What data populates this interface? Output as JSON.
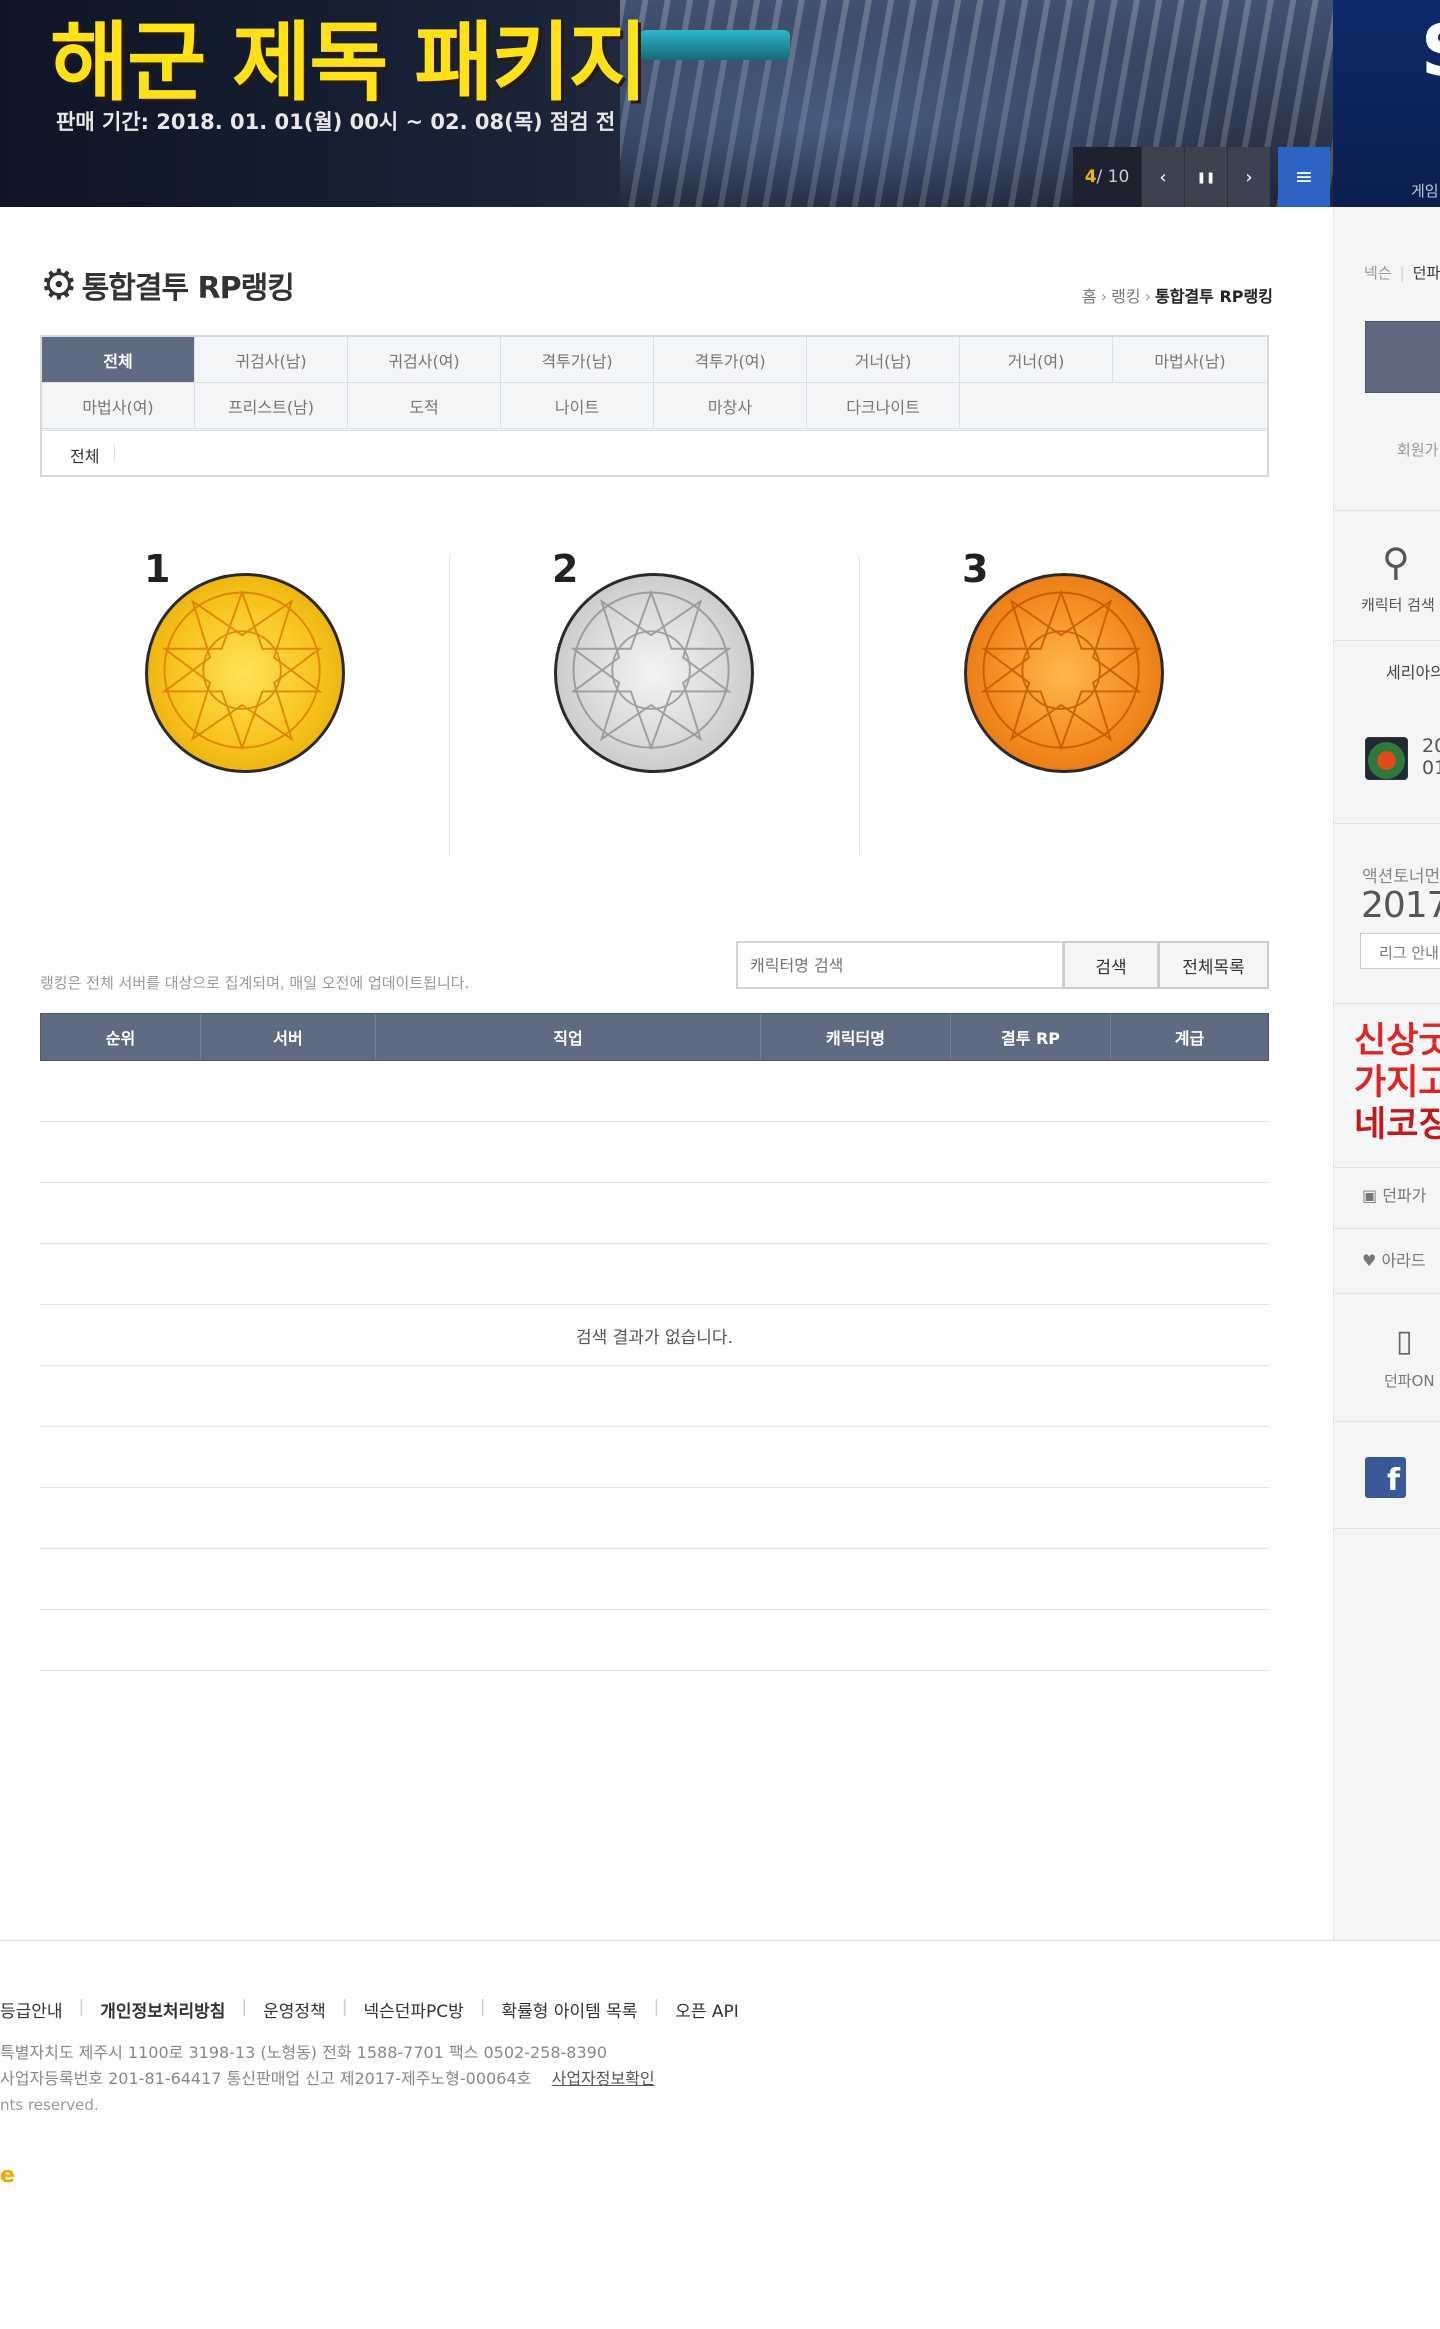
{
  "banner": {
    "title": "해군 제독 패키지",
    "subtitle": "판매 기간: 2018. 01. 01(월) 00시 ~ 02. 08(목) 점검 전",
    "counter_current": "4",
    "counter_total": "/ 10",
    "prev_icon": "‹",
    "pause_icon": "❚❚",
    "next_icon": "›",
    "menu_icon": "≡",
    "right_letter": "S",
    "right_label": "게임"
  },
  "sidebar": {
    "login_left": "넥슨",
    "login_right": "던파",
    "join": "회원가",
    "char_search": "캐릭터 검색",
    "server": "세리아의",
    "avatar_num1": "20",
    "avatar_num2": "01",
    "tournament": "액션토너먼",
    "year": "2017 I",
    "league": "리그 안내",
    "ad_line1": "신상굿",
    "ad_line2": "가지고",
    "ad_line3": "네코징",
    "dfg": "던파가",
    "ara": "아라드",
    "dfon": "던파ON",
    "fb": "f"
  },
  "page": {
    "title": "통합결투 RP랭킹",
    "breadcrumb": [
      "홈",
      "랭킹",
      "통합결투 RP랭킹"
    ]
  },
  "tabs": [
    {
      "label": "전체",
      "active": true
    },
    {
      "label": "귀검사(남)"
    },
    {
      "label": "귀검사(여)"
    },
    {
      "label": "격투가(남)"
    },
    {
      "label": "격투가(여)"
    },
    {
      "label": "거너(남)"
    },
    {
      "label": "거너(여)"
    },
    {
      "label": "마법사(남)"
    },
    {
      "label": "마법사(여)"
    },
    {
      "label": "프리스트(남)"
    },
    {
      "label": "도적"
    },
    {
      "label": "나이트"
    },
    {
      "label": "마창사"
    },
    {
      "label": "다크나이트"
    }
  ],
  "subtab": "전체",
  "medals": [
    "1",
    "2",
    "3"
  ],
  "search": {
    "notice": "랭킹은 전체 서버를 대상으로 집계되며, 매일 오전에 업데이트됩니다.",
    "placeholder": "캐릭터명 검색",
    "search_btn": "검색",
    "list_btn": "전체목록"
  },
  "table": {
    "headers": [
      "순위",
      "서버",
      "직업",
      "캐릭터명",
      "결투 RP",
      "계급"
    ],
    "empty_message": "검색 결과가 없습니다."
  },
  "footer": {
    "links": [
      "등급안내",
      "개인정보처리방침",
      "운영정책",
      "넥슨던파PC방",
      "확률형 아이템 목록",
      "오픈 API"
    ],
    "address": "특별자치도 제주시 1100로 3198-13 (노형동)    전화 1588-7701    팩스 0502-258-8390",
    "registration": "사업자등록번호 201-81-64417    통신판매업 신고 제2017-제주노형-00064호",
    "biz_info": "사업자정보확인",
    "copyright": "nts reserved.",
    "logo": "e"
  }
}
